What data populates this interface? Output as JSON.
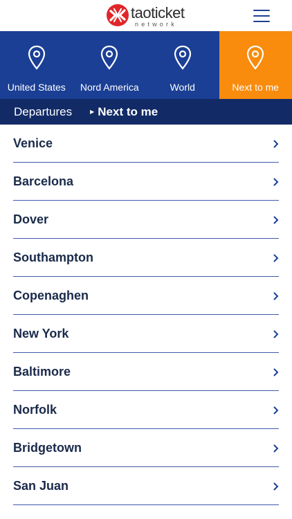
{
  "header": {
    "logo_word": "taoticket",
    "logo_sub": "network",
    "menu_icon": "hamburger-icon"
  },
  "colors": {
    "nav_blue": "#1b3f95",
    "subbar_navy": "#122a66",
    "active_orange": "#f98b0d",
    "logo_red": "#e0262a"
  },
  "regions": [
    {
      "label": "United States",
      "icon": "location-pin-icon",
      "active": false
    },
    {
      "label": "Nord America",
      "icon": "location-pin-icon",
      "active": false
    },
    {
      "label": "World",
      "icon": "location-pin-icon",
      "active": false
    },
    {
      "label": "Next to me",
      "icon": "location-pin-icon",
      "active": true
    }
  ],
  "subbar": {
    "back_label": "Departures",
    "current_label": "Next to me"
  },
  "cities": [
    "Venice",
    "Barcelona",
    "Dover",
    "Southampton",
    "Copenaghen",
    "New York",
    "Baltimore",
    "Norfolk",
    "Bridgetown",
    "San Juan"
  ]
}
